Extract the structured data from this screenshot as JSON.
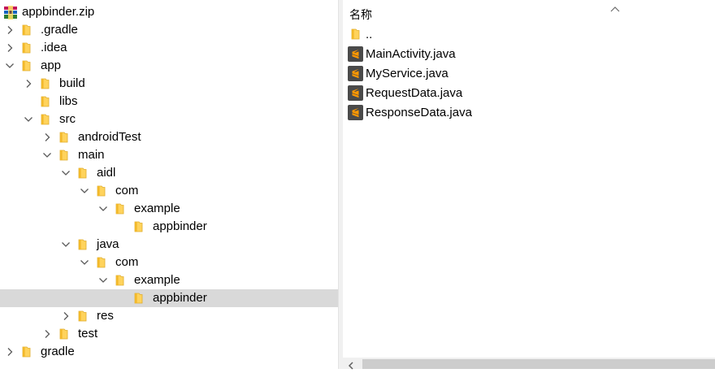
{
  "tree": {
    "root": {
      "label": "appbinder.zip",
      "icon": "winrar-archive-icon"
    },
    "nodes": [
      {
        "label": ".gradle",
        "depth": 0,
        "expander": "collapsed"
      },
      {
        "label": ".idea",
        "depth": 0,
        "expander": "collapsed"
      },
      {
        "label": "app",
        "depth": 0,
        "expander": "expanded"
      },
      {
        "label": "build",
        "depth": 1,
        "expander": "collapsed"
      },
      {
        "label": "libs",
        "depth": 1,
        "expander": "none"
      },
      {
        "label": "src",
        "depth": 1,
        "expander": "expanded"
      },
      {
        "label": "androidTest",
        "depth": 2,
        "expander": "collapsed"
      },
      {
        "label": "main",
        "depth": 2,
        "expander": "expanded"
      },
      {
        "label": "aidl",
        "depth": 3,
        "expander": "expanded"
      },
      {
        "label": "com",
        "depth": 4,
        "expander": "expanded"
      },
      {
        "label": "example",
        "depth": 5,
        "expander": "expanded"
      },
      {
        "label": "appbinder",
        "depth": 6,
        "expander": "none"
      },
      {
        "label": "java",
        "depth": 3,
        "expander": "expanded"
      },
      {
        "label": "com",
        "depth": 4,
        "expander": "expanded"
      },
      {
        "label": "example",
        "depth": 5,
        "expander": "expanded"
      },
      {
        "label": "appbinder",
        "depth": 6,
        "expander": "none",
        "selected": true
      },
      {
        "label": "res",
        "depth": 3,
        "expander": "collapsed"
      },
      {
        "label": "test",
        "depth": 2,
        "expander": "collapsed"
      },
      {
        "label": "gradle",
        "depth": 0,
        "expander": "collapsed"
      }
    ]
  },
  "list": {
    "column_header": "名称",
    "sort_indicator": "sort-ascending-icon",
    "items": [
      {
        "name": "..",
        "icon": "folder-icon"
      },
      {
        "name": "MainActivity.java",
        "icon": "sublime-file-icon"
      },
      {
        "name": "MyService.java",
        "icon": "sublime-file-icon"
      },
      {
        "name": "RequestData.java",
        "icon": "sublime-file-icon"
      },
      {
        "name": "ResponseData.java",
        "icon": "sublime-file-icon"
      }
    ]
  },
  "colors": {
    "selection": "#d9d9d9",
    "folder_yellow": "#ffd35c",
    "sublime_orange": "#ff9800",
    "sublime_dark": "#4a4a4a"
  }
}
